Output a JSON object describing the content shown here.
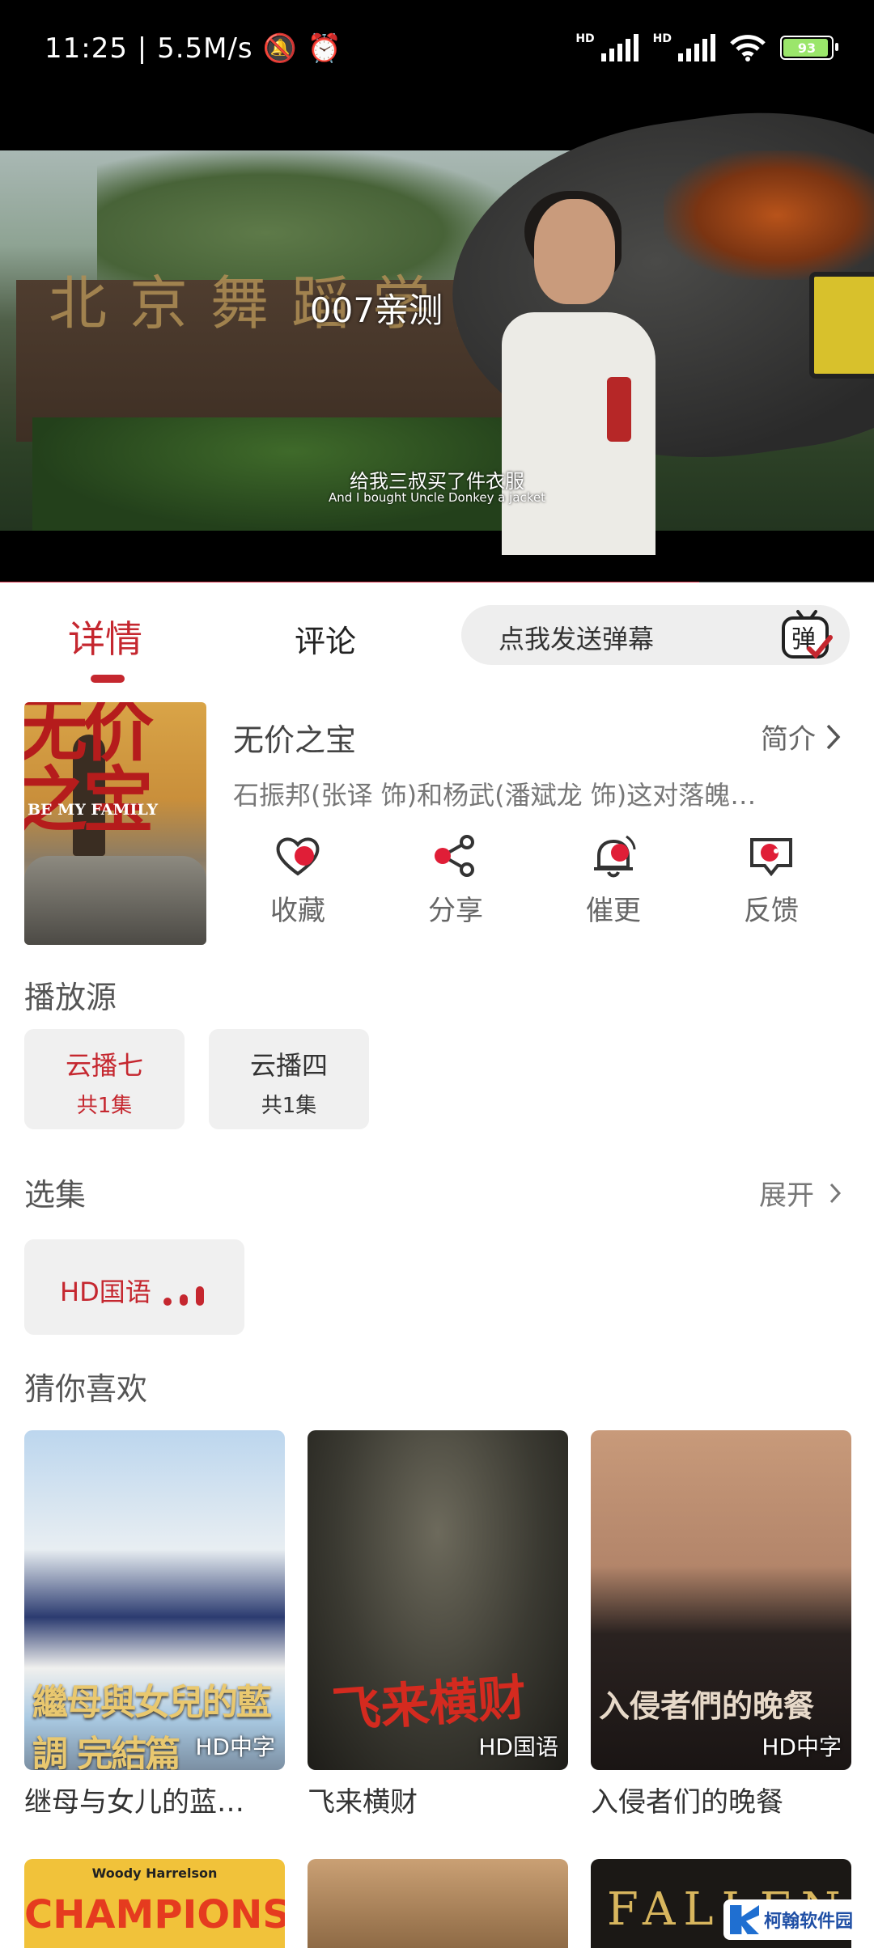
{
  "status_bar": {
    "time": "11:25",
    "speed": "5.5M/s",
    "hd1": "HD",
    "hd2": "HD",
    "battery": "93"
  },
  "video": {
    "title": "007亲测",
    "wall_text": "北京舞蹈学院",
    "subtitle_cn": "给我三叔买了件衣服",
    "subtitle_en": "And I bought Uncle Donkey a jacket",
    "progress": 0.8
  },
  "tabs": {
    "detail": "详情",
    "comments": "评论",
    "danmu_placeholder": "点我发送弹幕",
    "danmu_icon_text": "弹"
  },
  "movie": {
    "poster_title": "无价之宝",
    "poster_en": "BE MY FAMILY",
    "title": "无价之宝",
    "intro_label": "简介",
    "description": "石振邦(张译 饰)和杨武(潘斌龙 饰)这对落魄…",
    "actions": [
      {
        "label": "收藏",
        "icon": "heart-icon"
      },
      {
        "label": "分享",
        "icon": "share-icon"
      },
      {
        "label": "催更",
        "icon": "bell-icon"
      },
      {
        "label": "反馈",
        "icon": "feedback-icon"
      }
    ]
  },
  "sources": {
    "heading": "播放源",
    "items": [
      {
        "name": "云播七",
        "count": "共1集",
        "active": true
      },
      {
        "name": "云播四",
        "count": "共1集",
        "active": false
      }
    ]
  },
  "episodes": {
    "heading": "选集",
    "expand_label": "展开",
    "items": [
      {
        "label": "HD国语"
      }
    ]
  },
  "recommend": {
    "heading": "猜你喜欢",
    "items": [
      {
        "title": "继母与女儿的蓝…",
        "tag": "HD中字",
        "poster_text": "繼母與女兒的藍調 完結篇"
      },
      {
        "title": "飞来横财",
        "tag": "HD国语",
        "poster_text": "飞来横财"
      },
      {
        "title": "入侵者们的晚餐",
        "tag": "HD中字",
        "poster_text": "入侵者們的晚餐"
      }
    ],
    "next_row": [
      {
        "poster_text": "CHAMPIONS",
        "top_text": "Woody Harrelson"
      },
      {
        "poster_text": ""
      },
      {
        "poster_text": "FALLEN"
      }
    ]
  },
  "watermark": {
    "text": "柯翰软件园"
  },
  "colors": {
    "accent": "#c5272f",
    "chip_bg": "#f0f0f0"
  }
}
